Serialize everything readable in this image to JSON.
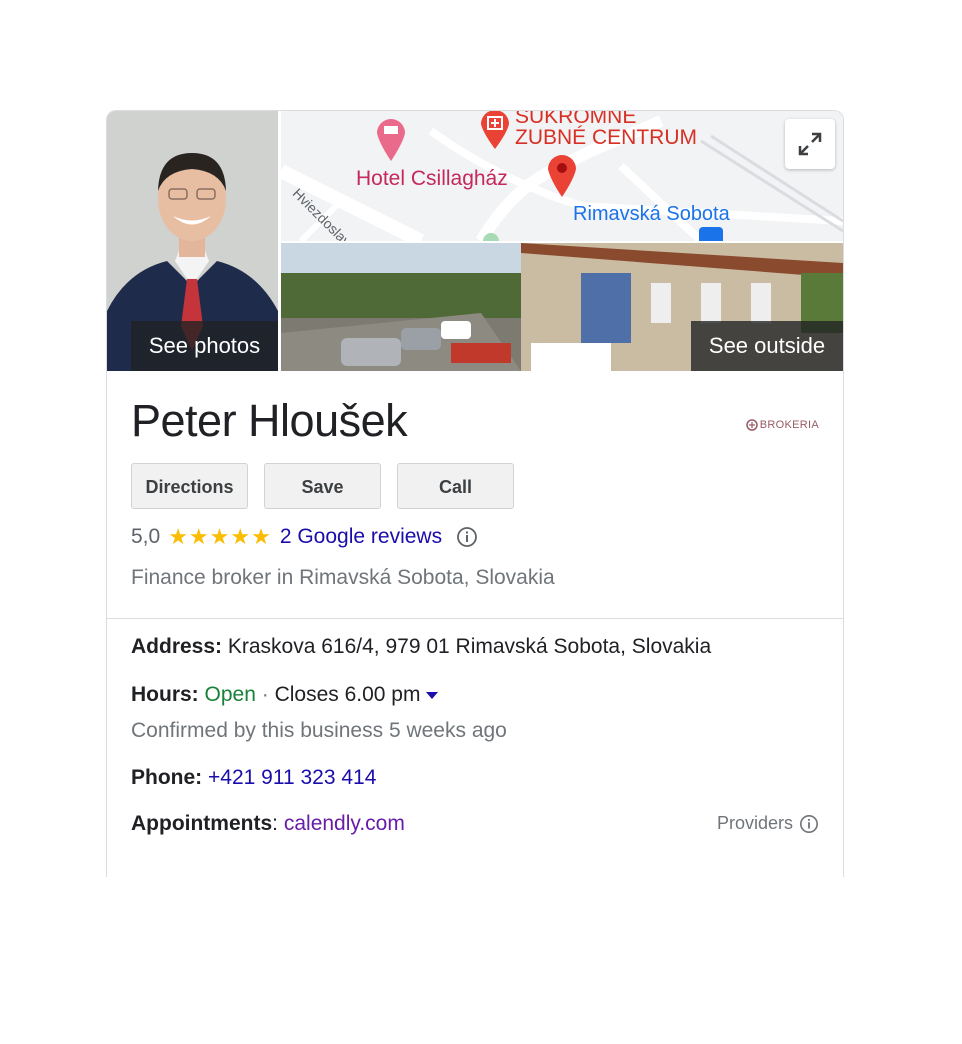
{
  "media": {
    "see_photos": "See photos",
    "see_outside": "See outside"
  },
  "map": {
    "labels": {
      "clinic_top": "SÚKROMNÉ",
      "clinic": "ZUBNÉ CENTRUM",
      "hotel": "Hotel Csillagház",
      "street": "Hviezdoslavov",
      "town": "Rimavská Sobota"
    }
  },
  "business": {
    "name": "Peter Hloušek",
    "logo_text": "BROKERIA",
    "rating": "5,0",
    "stars": "★★★★★",
    "reviews": "2 Google reviews",
    "category": "Finance broker in Rimavská Sobota, Slovakia"
  },
  "actions": {
    "directions": "Directions",
    "save": "Save",
    "call": "Call"
  },
  "details": {
    "address_label": "Address:",
    "address": "Kraskova 616/4, 979 01 Rimavská Sobota, Slovakia",
    "hours_label": "Hours:",
    "hours_status": "Open",
    "hours_sep": "·",
    "hours_close": "Closes 6.00 pm",
    "confirmed": "Confirmed by this business 5 weeks ago",
    "phone_label": "Phone:",
    "phone": "+421 911 323 414",
    "appointments_label": "Appointments",
    "appointments_sep": ":",
    "appointments_link": "calendly.com",
    "providers": "Providers"
  },
  "colors": {
    "link_blue": "#1a0dab",
    "open_green": "#188038",
    "visited_purple": "#681da8",
    "star_yellow": "#fbbc04",
    "pin_red": "#ea4335"
  }
}
